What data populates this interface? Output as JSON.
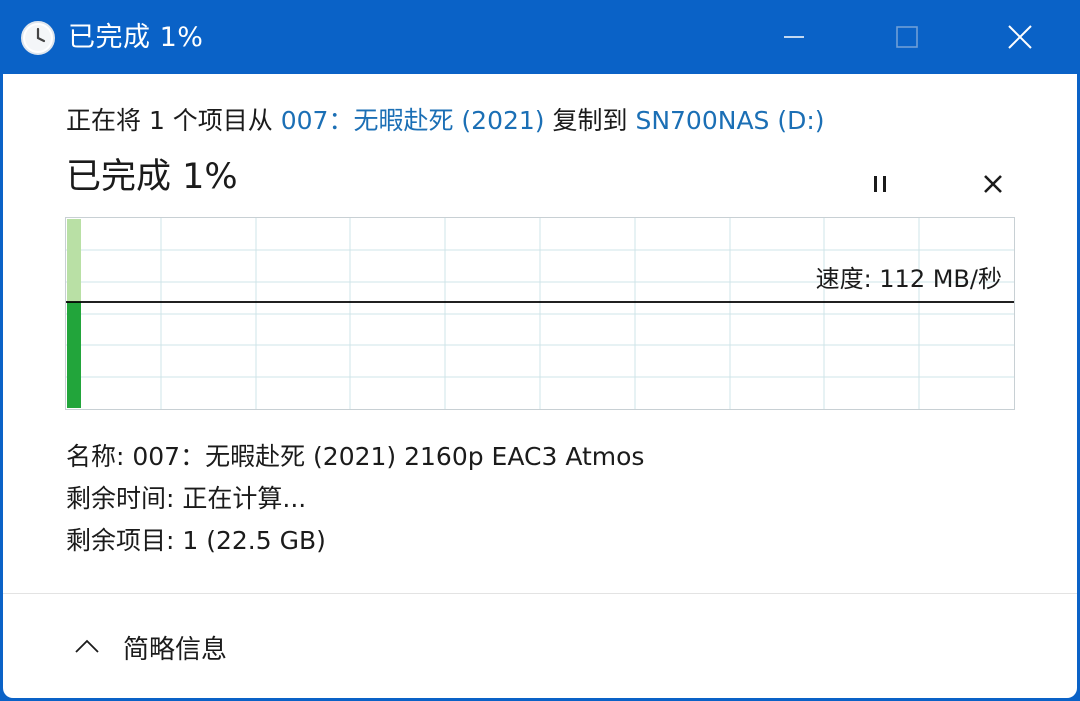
{
  "window": {
    "title": "已完成 1%"
  },
  "copy": {
    "prefix": "正在将 1 个项目从 ",
    "source": "007：无暇赴死 (2021)",
    "middle": " 复制到 ",
    "destination": "SN700NAS (D:)"
  },
  "progress": {
    "title": "已完成 1%",
    "percent": 1,
    "speed_label": "速度: 112 MB/秒"
  },
  "details": {
    "name_label": "名称: ",
    "name_value": "007：无暇赴死 (2021) 2160p EAC3 Atmos",
    "time_label": "剩余时间: ",
    "time_value": "正在计算...",
    "items_label": "剩余项目: ",
    "items_value": "1 (22.5 GB)"
  },
  "footer": {
    "toggle_label": "简略信息"
  },
  "icons": {
    "app": "clock-icon",
    "minimize": "minimize-icon",
    "maximize": "maximize-icon",
    "close": "close-icon",
    "pause": "pause-icon",
    "cancel": "cancel-icon",
    "collapse": "chevron-up-icon"
  },
  "colors": {
    "title_bar": "#0a62c7",
    "link": "#1b6fb5",
    "progress_fill_light": "#b9e0a5",
    "progress_fill_dark": "#22a53b",
    "grid": "#cfe4e8",
    "speed_line": "#000000"
  }
}
